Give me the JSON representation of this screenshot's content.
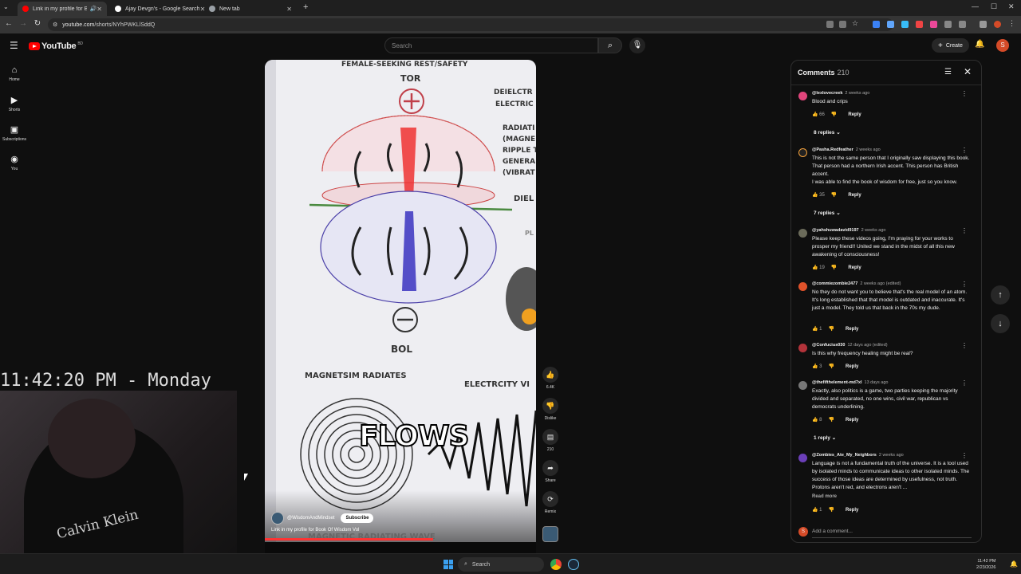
{
  "browser": {
    "tabs": [
      {
        "label": "Link in my profile for Book",
        "active": true,
        "favicon_color": "#ff0000"
      },
      {
        "label": "Ajay Devgn's - Google Search",
        "active": false,
        "favicon_color": "#ffffff"
      },
      {
        "label": "New tab",
        "active": false,
        "favicon_color": "#9aa0a6"
      }
    ],
    "url_host": "youtube.com",
    "url_path": "/shorts/NYhPWKLlSddQ"
  },
  "youtube": {
    "logo_text": "YouTube",
    "logo_badge": "BD",
    "search_placeholder": "Search",
    "create_label": "Create",
    "avatar_letter": "S",
    "sidebar": [
      {
        "label": "Home",
        "icon": "home-icon"
      },
      {
        "label": "Shorts",
        "icon": "shorts-icon"
      },
      {
        "label": "Subscriptions",
        "icon": "subscriptions-icon"
      },
      {
        "label": "You",
        "icon": "you-icon"
      }
    ]
  },
  "overlay": {
    "clock": "11:42:20 PM - Monday",
    "shirt_text": "Calvin Klein"
  },
  "video": {
    "texts": {
      "top": "FEMALE-SEEKING REST/SAFETY",
      "tor": "TOR",
      "right1": "DEIELCTR",
      "right2": "ELECTRIC",
      "right3": "RADIATI",
      "right4": "(MAGNE",
      "right5": "RIPPLE T",
      "right6": "GENERA",
      "right7": "(VIBRAT",
      "diel": "DIEL",
      "pl": "PL",
      "bol": "BOL",
      "magnetism": "MAGNETSIM RADIATES",
      "electricity": "ELECTRCITY VI",
      "bottom": "MAGNETIC RADIATING WAVE"
    },
    "caption": "FLOWS",
    "channel": "@WisdomAndMindset",
    "subscribe_label": "Subscribe",
    "title": "Link in my profile for Book Of Wisdom Vol",
    "progress": 0.62
  },
  "actions": {
    "likes": "6.4K",
    "dislike": "Dislike",
    "comments": "210",
    "share": "Share",
    "remix": "Remix"
  },
  "comments_panel": {
    "title": "Comments",
    "count": "210",
    "add_placeholder": "Add a comment...",
    "comments": [
      {
        "handle": "@lexlovecreek",
        "time": "2 weeks ago",
        "text": "Blood and crips",
        "likes": "66",
        "avatar_color": "#e0457b",
        "replies": "8 replies"
      },
      {
        "handle": "@Pasha.Redfeather",
        "time": "2 weeks ago",
        "text": "This is not the same person that I originally saw displaying this book. That person had a northern Irish accent. This person has British accent.\nI was able to find the book of wisdom for free, just so you know.",
        "likes": "35",
        "avatar_color": "#222222",
        "replies": "7 replies"
      },
      {
        "handle": "@yahshuwadavid9197",
        "time": "2 weeks ago",
        "text": "Please keep these videos going, I'm praying for your works to prosper my friend!! United we stand in the midst of all this new awakening of consciousness!",
        "likes": "19",
        "avatar_color": "#6b6b5a",
        "replies": ""
      },
      {
        "handle": "@commiezombie2477",
        "time": "2 weeks ago (edited)",
        "text": "No they do not want you to believe that's the real model of an atom. It's long established that that model is outdated and inaccurate. It's just a model. They told us that back in the 70s my dude.",
        "likes": "1",
        "avatar_color": "#e0522a",
        "replies": ""
      },
      {
        "handle": "@Confucius030",
        "time": "12 days ago (edited)",
        "text": "Is this why frequency healing might be real?",
        "likes": "3",
        "avatar_color": "#b3333a",
        "replies": ""
      },
      {
        "handle": "@thefifthelement-md7xl",
        "time": "13 days ago",
        "text": "Exactly, also politics is a game, two parties keeping the majority divided and separated, no one wins, civil war, republican vs democrats underlining.",
        "likes": "8",
        "avatar_color": "#777777",
        "replies": "1 reply"
      },
      {
        "handle": "@Zombies_Ate_My_Neighbors",
        "time": "2 weeks ago",
        "text": "Language is not a fundamental truth of the universe.  It is a tool used by isolated minds to communicate ideas to other isolated minds.  The success of those ideas are determined by usefulness, not truth.  Protons aren't red, and electrons aren't ...",
        "likes": "1",
        "avatar_color": "#6b3fb8",
        "replies": "",
        "read_more": "Read more"
      }
    ],
    "reply_label": "Reply"
  },
  "taskbar": {
    "search_label": "Search",
    "time": "11:42 PM",
    "date": "2/23/2026"
  }
}
